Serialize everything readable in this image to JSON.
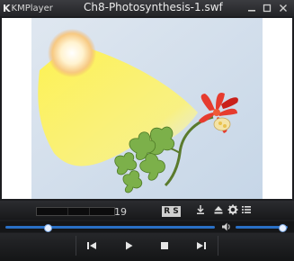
{
  "window": {
    "app_name": "KMPlayer",
    "file_title": "Ch8-Photosynthesis-1.swf"
  },
  "status": {
    "counter_value": "19",
    "ab_repeat_label": "R S"
  },
  "colors": {
    "accent": "#2a70c6",
    "window_bg": "#1c1d20",
    "video_bg": "#dde7f1"
  },
  "icons": {
    "minimize": "minimize-icon",
    "restore": "restore-icon",
    "close": "close-icon",
    "download": "download-icon",
    "eject": "eject-icon",
    "settings": "gear-icon",
    "playlist": "list-icon",
    "volume": "speaker-icon"
  },
  "playback": {
    "seek_fraction": 0.2,
    "volume_fraction": 0.9
  }
}
